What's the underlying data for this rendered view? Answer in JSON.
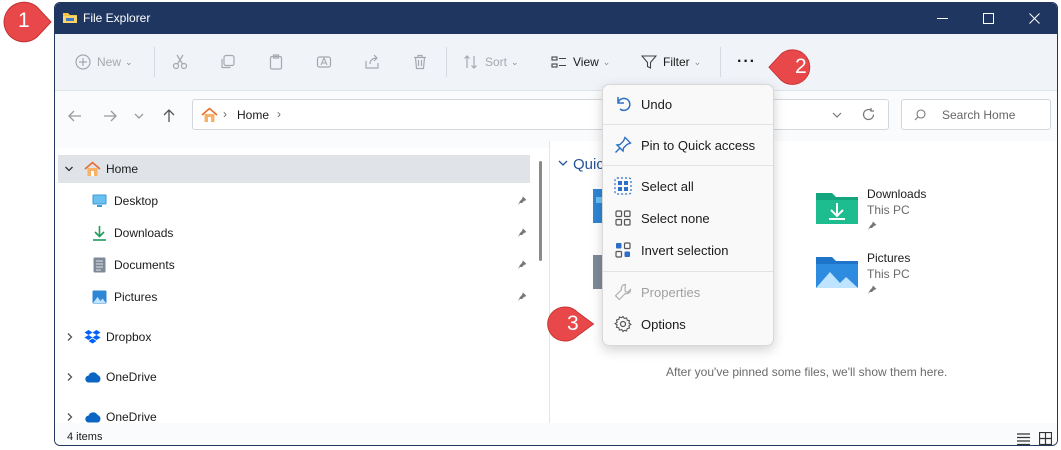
{
  "window": {
    "title": "File Explorer",
    "controls": [
      "minimize-icon",
      "maximize-icon",
      "close-icon"
    ]
  },
  "toolbar": {
    "new_label": "New",
    "sort_label": "Sort",
    "view_label": "View",
    "filter_label": "Filter",
    "more_label": "···"
  },
  "address": {
    "breadcrumb_home": "Home",
    "search_placeholder": "Search Home"
  },
  "nav": {
    "items": [
      {
        "label": "Home",
        "icon": "home-icon",
        "selected": true
      },
      {
        "label": "Desktop",
        "icon": "desktop-icon",
        "pinned": true
      },
      {
        "label": "Downloads",
        "icon": "download-icon",
        "pinned": true
      },
      {
        "label": "Documents",
        "icon": "documents-icon",
        "pinned": true
      },
      {
        "label": "Pictures",
        "icon": "pictures-icon",
        "pinned": true
      },
      {
        "label": "Dropbox",
        "icon": "dropbox-icon"
      },
      {
        "label": "OneDrive",
        "icon": "onedrive-icon"
      },
      {
        "label": "OneDrive",
        "icon": "onedrive-icon"
      }
    ]
  },
  "content": {
    "quick_access_title": "Quic",
    "tiles": [
      {
        "name": "Downloads",
        "location": "This PC"
      },
      {
        "name": "Pictures",
        "location": "This PC"
      }
    ],
    "empty_message": "After you've pinned some files, we'll show them here."
  },
  "menu": {
    "items": [
      {
        "label": "Undo",
        "icon": "undo-icon"
      },
      {
        "label": "Pin to Quick access",
        "icon": "pin-icon"
      },
      {
        "label": "Select all",
        "icon": "select-all-icon"
      },
      {
        "label": "Select none",
        "icon": "select-none-icon"
      },
      {
        "label": "Invert selection",
        "icon": "invert-selection-icon"
      },
      {
        "label": "Properties",
        "icon": "wrench-icon",
        "disabled": true
      },
      {
        "label": "Options",
        "icon": "gear-icon"
      }
    ]
  },
  "status": {
    "item_count": "4 items"
  },
  "callouts": {
    "one": "1",
    "two": "2",
    "three": "3",
    "color": "#e8484a"
  },
  "colors": {
    "titlebar": "#1f3660",
    "accent": "#24549b",
    "selected_row": "#e0e3e8"
  }
}
